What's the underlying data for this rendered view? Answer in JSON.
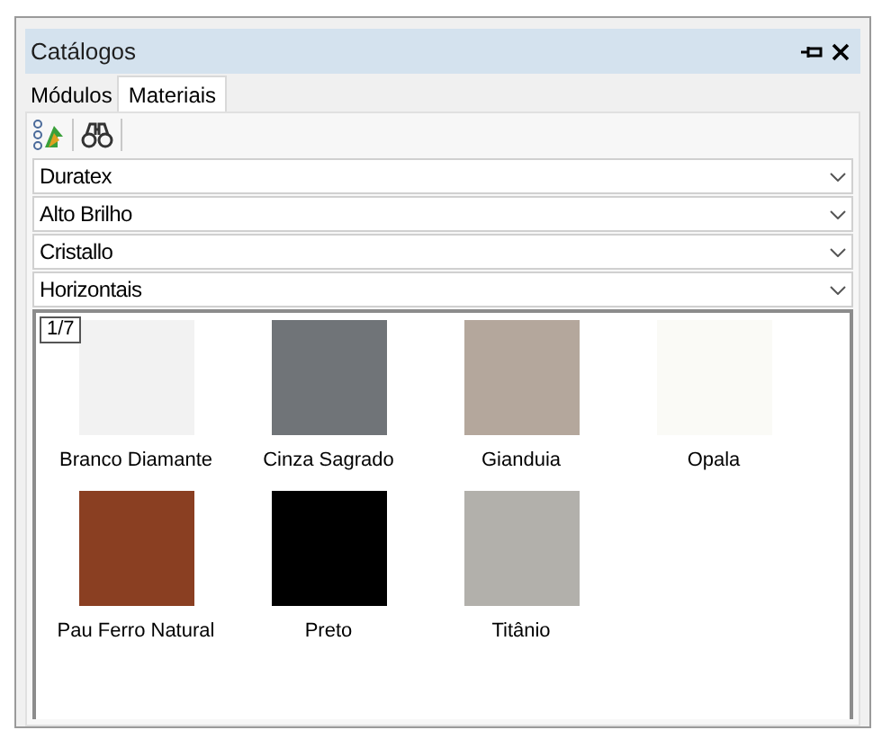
{
  "window": {
    "title": "Catálogos"
  },
  "tabs": [
    {
      "label": "Módulos",
      "selected": false
    },
    {
      "label": "Materiais",
      "selected": true
    }
  ],
  "filters": [
    {
      "value": "Duratex"
    },
    {
      "value": "Alto Brilho"
    },
    {
      "value": "Cristallo"
    },
    {
      "value": "Horizontais"
    }
  ],
  "gallery": {
    "page": "1/7",
    "materials": [
      {
        "name": "Branco Diamante",
        "color": "#f2f2f2"
      },
      {
        "name": "Cinza Sagrado",
        "color": "#707478"
      },
      {
        "name": "Gianduia",
        "color": "#b4a79c"
      },
      {
        "name": "Opala",
        "color": "#fafaf6"
      },
      {
        "name": "Pau Ferro Natural",
        "color": "#8a3f22"
      },
      {
        "name": "Preto",
        "color": "#000000"
      },
      {
        "name": "Titânio",
        "color": "#b2b0ab"
      }
    ]
  }
}
